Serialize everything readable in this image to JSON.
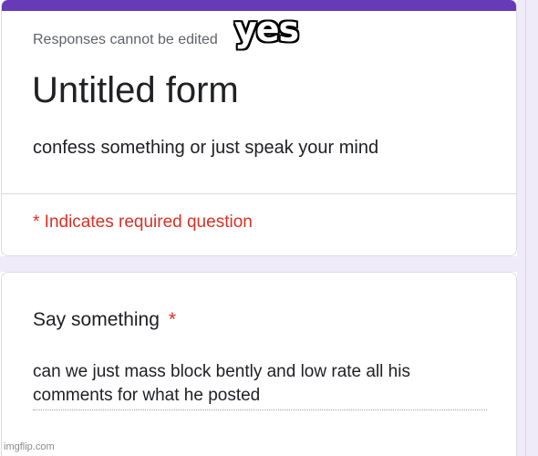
{
  "caption": "yes",
  "form": {
    "notice": "Responses cannot be edited",
    "title": "Untitled form",
    "description": "confess something or just speak your mind",
    "required_note": "* Indicates required question"
  },
  "question": {
    "title": "Say something",
    "required_marker": "*",
    "answer": "can we just mass block bently and low rate all his comments for what he posted"
  },
  "watermark": "imgflip.com",
  "colors": {
    "accent": "#673ab7",
    "required": "#d93025",
    "background": "#f0ebf8"
  }
}
